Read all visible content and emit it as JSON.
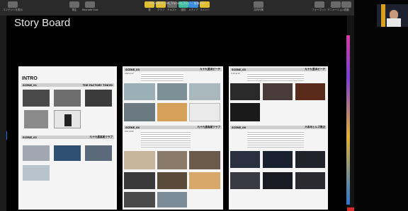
{
  "app": {
    "doc_title": "20220804_Old_Training_2(2) — 編集済み"
  },
  "toolbar": {
    "buttons": [
      {
        "name": "view-button",
        "label": "コンテンツを表示"
      },
      {
        "name": "play-button",
        "label": "再生"
      },
      {
        "name": "keynote-live-button",
        "label": "Keynote Live"
      },
      {
        "name": "table-button",
        "label": "表"
      },
      {
        "name": "chart-button",
        "label": "グラフ"
      },
      {
        "name": "text-button",
        "label": "テキスト"
      },
      {
        "name": "shape-button",
        "label": "図形"
      },
      {
        "name": "media-button",
        "label": "メディア"
      },
      {
        "name": "comment-button",
        "label": "コメント"
      },
      {
        "name": "collaborate-button",
        "label": "共同作業"
      },
      {
        "name": "format-button",
        "label": "フォーマット"
      },
      {
        "name": "animate-button",
        "label": "アニメーション"
      },
      {
        "name": "document-button",
        "label": "書類"
      }
    ]
  },
  "slide": {
    "title": "Story Board"
  },
  "pages": {
    "p1": {
      "intro": "INTRO",
      "scene1": "SCENE_01",
      "scene1_place": "THE FACTORY TOKYO",
      "scene2": "SCENE_02",
      "scene2_place": "九十九里高尾クラブ"
    },
    "p2": {
      "scene3": "SCENE_03",
      "scene3_place": "九十九里浜ビーチ",
      "scene3_tc": "0:00-0:13",
      "scene4": "SCENE_04",
      "scene4_place": "九十九里高尾クラブ",
      "scene4_tc": "0:01-0:04"
    },
    "p3": {
      "scene5": "SCENE_05",
      "scene5_place": "九十九里浜ビーチ",
      "scene5_tc": "0:13-0:15",
      "scene6": "SCENE_06",
      "scene6_place": "六本木ヒルズ周辺"
    }
  },
  "colors": {
    "accent_blue": "#2d6be0",
    "accent_red": "#d92a2a"
  }
}
